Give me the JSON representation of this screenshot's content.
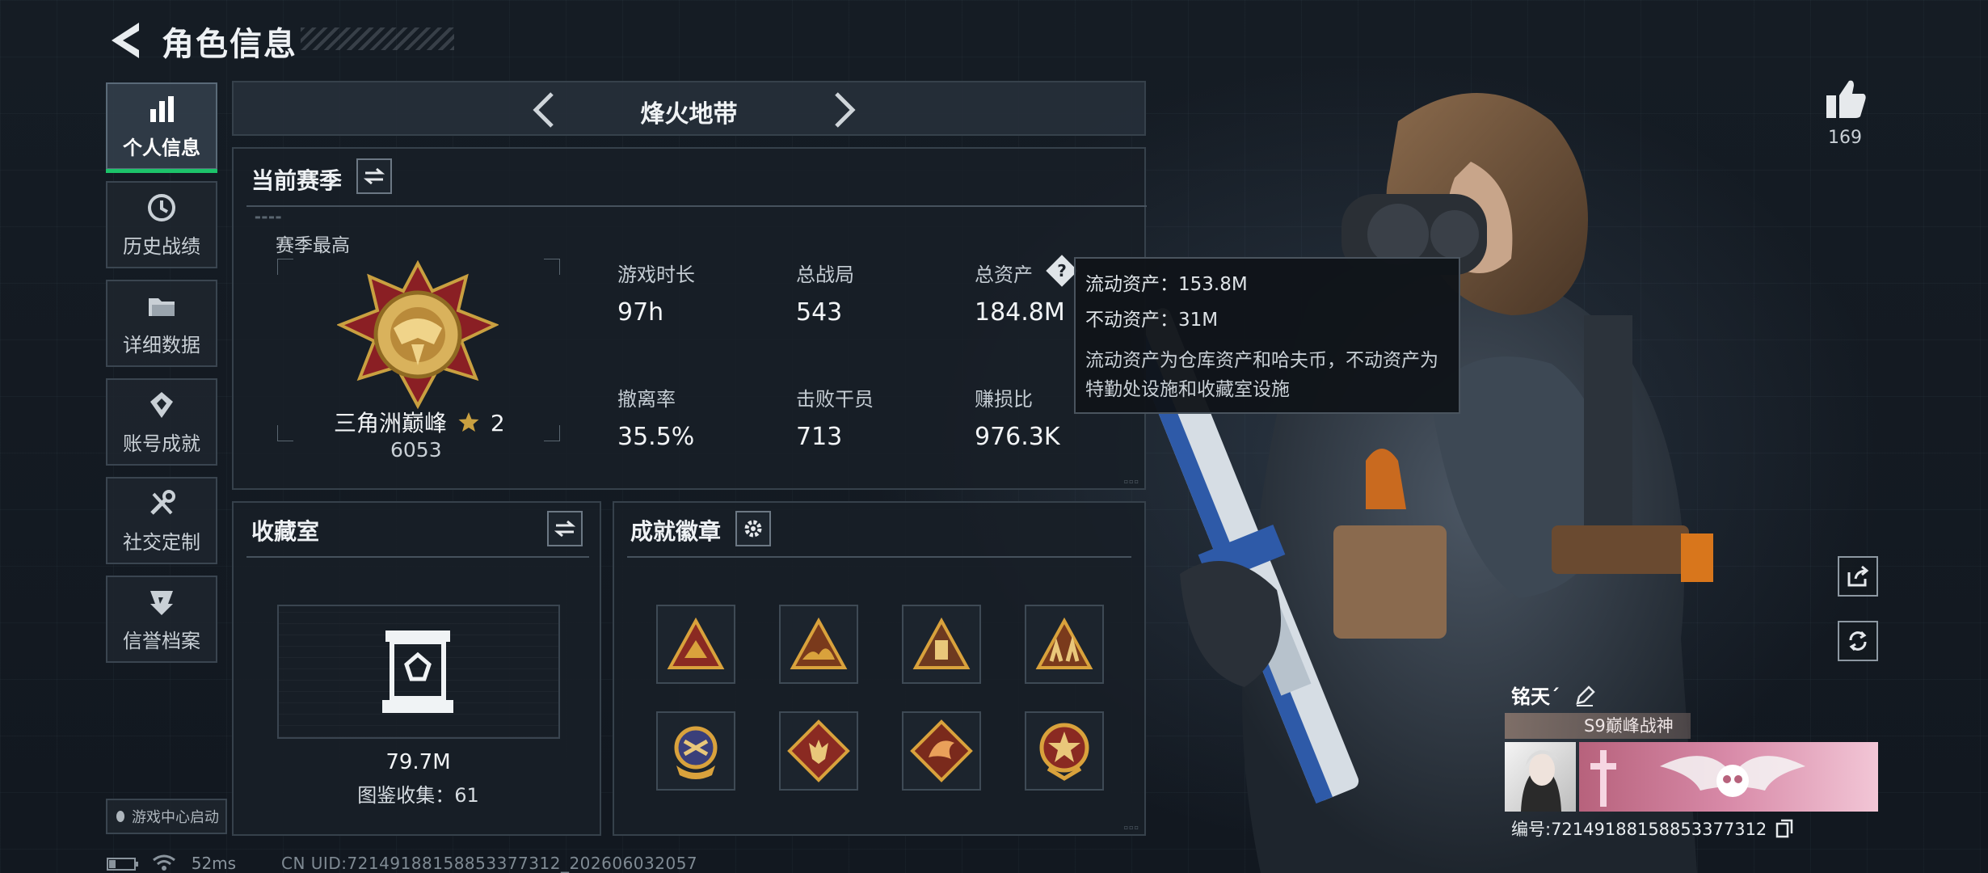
{
  "header": {
    "title": "角色信息"
  },
  "sidebar": {
    "items": [
      {
        "label": "个人信息",
        "icon": "bar-chart-icon",
        "active": true
      },
      {
        "label": "历史战绩",
        "icon": "history-clock-icon"
      },
      {
        "label": "详细数据",
        "icon": "folder-icon"
      },
      {
        "label": "账号成就",
        "icon": "achievement-icon"
      },
      {
        "label": "社交定制",
        "icon": "tools-icon"
      },
      {
        "label": "信誉档案",
        "icon": "credit-shield-icon"
      }
    ],
    "launch_label": "游戏中心启动"
  },
  "mode_nav": {
    "title": "烽火地带"
  },
  "season": {
    "title": "当前赛季",
    "best_label": "赛季最高",
    "rank_name": "三角洲巅峰",
    "rank_stars": "2",
    "rank_score": "6053",
    "stats": [
      {
        "label": "游戏时长",
        "value": "97h"
      },
      {
        "label": "总战局",
        "value": "543"
      },
      {
        "label": "总资产",
        "value": "184.8M"
      },
      {
        "label": "撤离率",
        "value": "35.5%"
      },
      {
        "label": "击败干员",
        "value": "713"
      },
      {
        "label": "赚损比",
        "value": "976.3K"
      }
    ],
    "help_glyph": "?"
  },
  "tooltip": {
    "liquid": "流动资产：153.8M",
    "fixed": "不动资产：31M",
    "description": "流动资产为仓库资产和哈夫币，不动资产为特勤处设施和收藏室设施"
  },
  "collection": {
    "title": "收藏室",
    "value": "79.7M",
    "codex": "图鉴收集：61"
  },
  "badges": {
    "title": "成就徽章",
    "items": [
      {
        "icon": "triangle-mountain-badge-icon"
      },
      {
        "icon": "triangle-wave-badge-icon"
      },
      {
        "icon": "triangle-tower-badge-icon"
      },
      {
        "icon": "triangle-soldiers-badge-icon"
      },
      {
        "icon": "emblem-wings-badge-icon"
      },
      {
        "icon": "diamond-wolf-badge-icon"
      },
      {
        "icon": "diamond-dragon-badge-icon"
      },
      {
        "icon": "star-circle-badge-icon"
      }
    ]
  },
  "profile": {
    "likes": "169",
    "player_name": "铭天´",
    "title_tag": "S9巅峰战神",
    "uid_line": "编号:7214918815885337731​2"
  },
  "status": {
    "ping": "52ms",
    "uid_full": "CN UID:7214918815885337731​2_202606032057"
  },
  "colors": {
    "accent_green": "#1cc36a",
    "gold": "#c9a040",
    "panel_border": "#36414b"
  }
}
